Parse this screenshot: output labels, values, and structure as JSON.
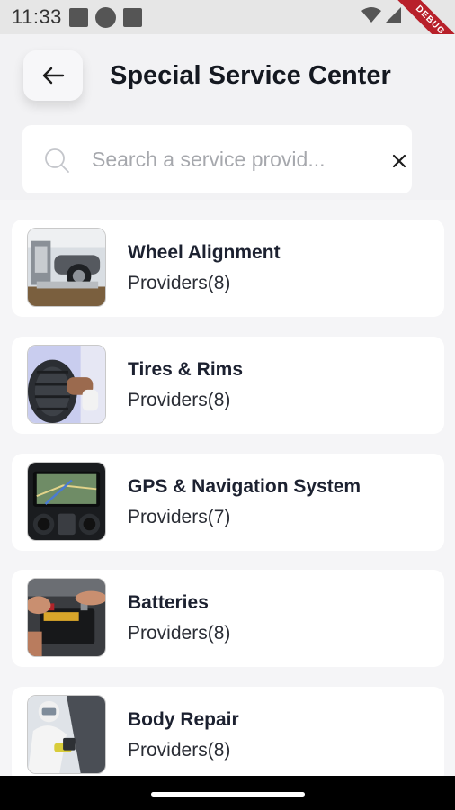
{
  "status_bar": {
    "time": "11:33"
  },
  "debug_label": "DEBUG",
  "header": {
    "title": "Special Service Center"
  },
  "search": {
    "placeholder": "Search a service provid...",
    "value": ""
  },
  "services": [
    {
      "name": "Wheel Alignment",
      "count_label": "Providers(8)",
      "image": "wheel-alignment-photo"
    },
    {
      "name": "Tires & Rims",
      "count_label": "Providers(8)",
      "image": "tires-rims-photo"
    },
    {
      "name": "GPS & Navigation System",
      "count_label": "Providers(7)",
      "image": "gps-navigation-photo"
    },
    {
      "name": "Batteries",
      "count_label": "Providers(8)",
      "image": "batteries-photo"
    },
    {
      "name": "Body Repair",
      "count_label": "Providers(8)",
      "image": "body-repair-photo"
    }
  ],
  "colors": {
    "background": "#f5f5f7",
    "card": "#ffffff",
    "text_primary": "#1c2130",
    "debug_ribbon": "#b8202a"
  }
}
